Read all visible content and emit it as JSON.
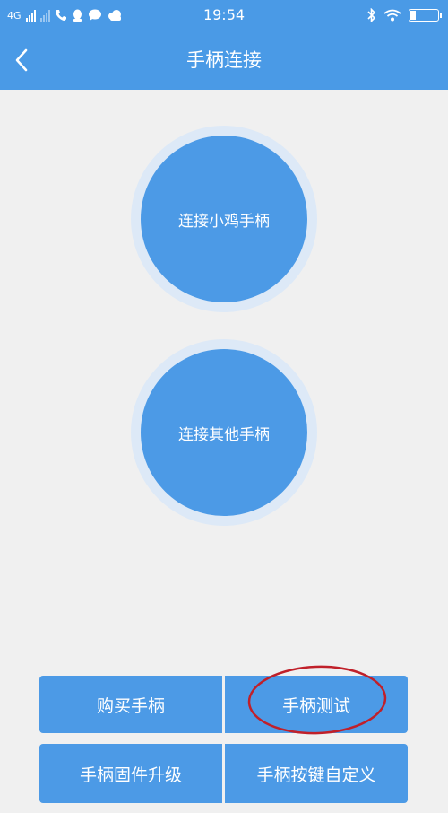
{
  "status_bar": {
    "network": "4G",
    "time": "19:54"
  },
  "header": {
    "title": "手柄连接",
    "back_icon": "chevron-left-icon"
  },
  "main": {
    "connect_chicken_label": "连接小鸡手柄",
    "connect_other_label": "连接其他手柄"
  },
  "menu": {
    "buy_label": "购买手柄",
    "test_label": "手柄测试",
    "firmware_label": "手柄固件升级",
    "customize_label": "手柄按键自定义"
  },
  "colors": {
    "primary": "#4a9ae6",
    "annotation": "#c0202a",
    "background": "#f0f0f0"
  }
}
